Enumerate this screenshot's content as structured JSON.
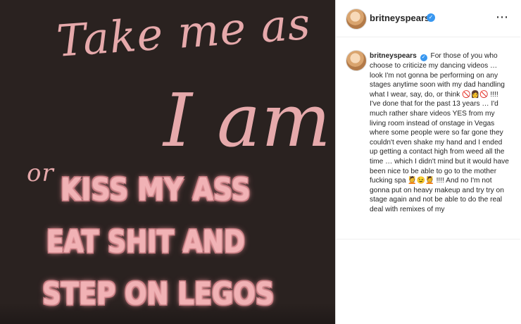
{
  "post_image": {
    "script_line_1": "Take me as",
    "script_line_2": "I am",
    "script_line_3": "or",
    "block_line_1": "KISS MY ASS",
    "block_line_2": "EAT SHIT AND",
    "block_line_3": "STEP ON LEGOS"
  },
  "header": {
    "username": "britneyspears",
    "verified_icon": "verified-check",
    "more_icon": "ellipsis-icon",
    "more_label": "⋯"
  },
  "caption": {
    "username": "britneyspears",
    "text_part_1": "For those of you who choose to criticize my dancing videos … look I'm not gonna be performing on any stages anytime soon with my dad handling what I wear, say, do, or think ",
    "emoji_1": "🚫👩🚫",
    "text_part_2": "!!!! I've done that for the past 13 years … I'd much rather share videos YES from my living room instead of onstage in Vegas where some people were so far gone they couldn't even shake my hand and I ended up getting a contact high from weed all the time … which I didn't mind but it would have been nice to be able to go to the mother fucking spa ",
    "emoji_2": "💆😉💆",
    "text_part_3": " !!!! And no I'm not gonna put on heavy makeup and try try on stage again and not be able to do the real deal with remixes of my"
  },
  "colors": {
    "image_background": "#2a2220",
    "script_pink": "#e6a9ab",
    "block_pink": "#f1b2b5",
    "verified_blue": "#3897f0",
    "text_dark": "#262626"
  }
}
